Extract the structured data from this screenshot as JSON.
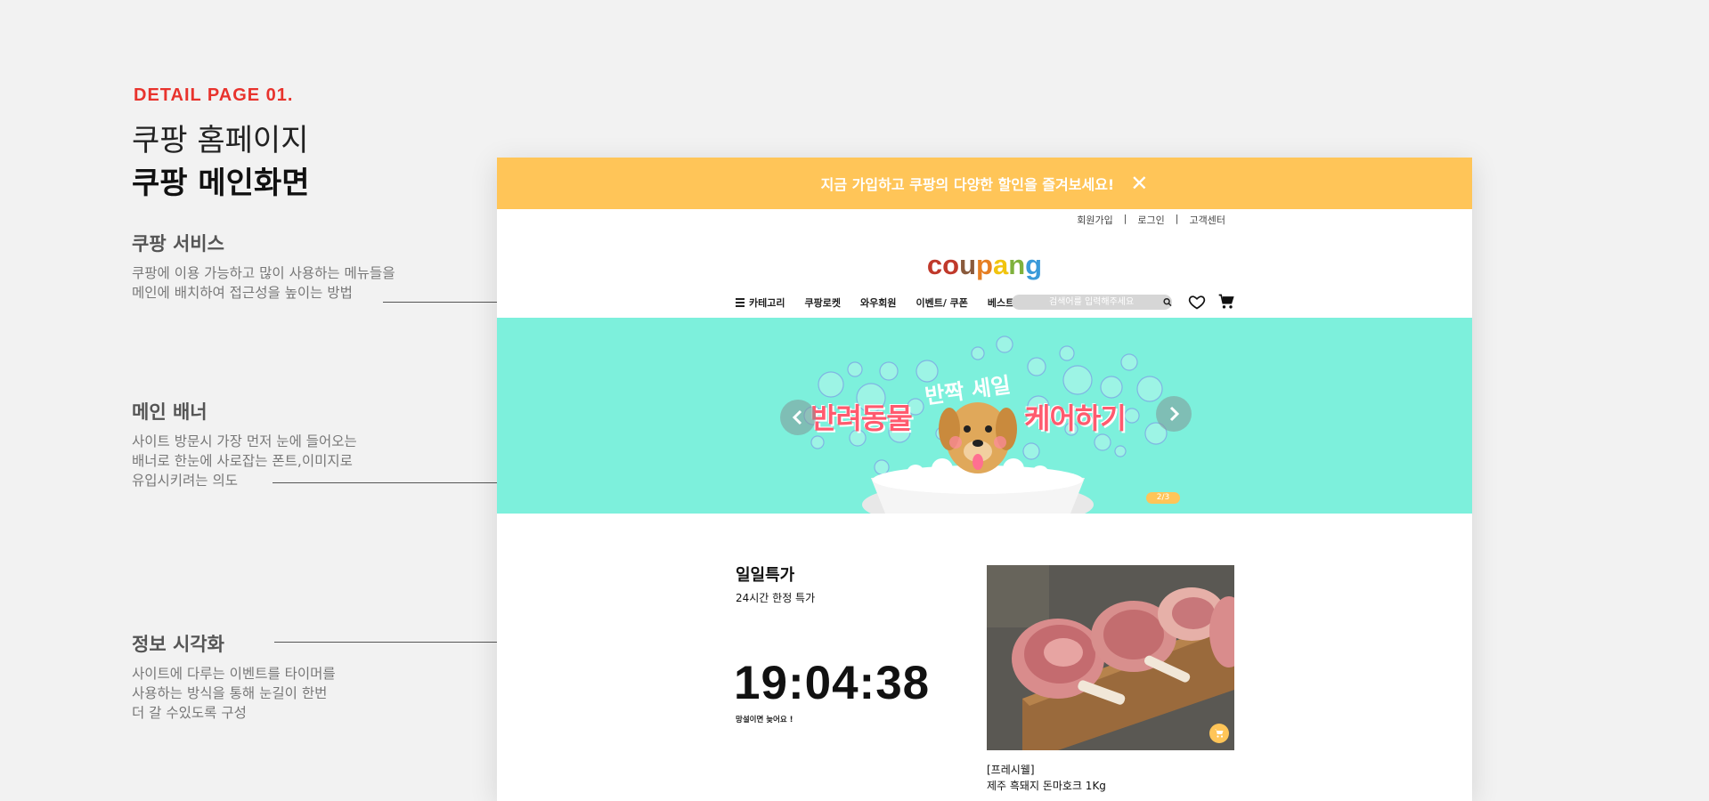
{
  "header": {
    "detail_label": "DETAIL PAGE 01.",
    "title_light": "쿠팡 홈페이지",
    "title_bold": "쿠팡 메인화면"
  },
  "annotations": [
    {
      "title": "쿠팡 서비스",
      "lines": [
        "쿠팡에 이용 가능하고 많이 사용하는  메뉴들을",
        "메인에 배치하여 접근성을 높이는 방법"
      ]
    },
    {
      "title": "메인 배너",
      "lines": [
        "사이트 방문시 가장 먼저 눈에 들어오는",
        "배너로 한눈에 사로잡는 폰트,이미지로",
        "유입시키려는 의도"
      ]
    },
    {
      "title": "정보 시각화",
      "lines": [
        "사이트에 다루는 이벤트를 타이머를",
        "사용하는 방식을 통해 눈길이 한번",
        "더 갈 수있도록 구성"
      ]
    }
  ],
  "site": {
    "promo_text": "지금 가입하고 쿠팡의 다양한 할인을 즐겨보세요!",
    "promo_close": "✕",
    "top_links": [
      "회원가입",
      "로그인",
      "고객센터"
    ],
    "logo_letters": [
      "c",
      "o",
      "u",
      "p",
      "a",
      "n",
      "g"
    ],
    "logo_colors": [
      "#c0392b",
      "#c0392b",
      "#8a5a3c",
      "#e67e22",
      "#f1c40f",
      "#7fb13d",
      "#3a9ad9"
    ],
    "nav": [
      "카테고리",
      "쿠팡로켓",
      "와우회원",
      "이벤트/ 쿠폰",
      "베스트"
    ],
    "search_placeholder": "검색어를 입력해주세요",
    "banner": {
      "main_left": "반려동물",
      "main_right": "케어하기",
      "sub": "반짝 세일",
      "pager": "2/3"
    },
    "deal": {
      "title": "일일특가",
      "subtitle": "24시간 한정 특가",
      "timer": "19:04:38",
      "note": "망설이면 늦어요 !",
      "product_brand": "[프레시웰]",
      "product_name": "제주 흑돼지 돈마호크 1Kg"
    },
    "colors": {
      "promo": "#ffc558",
      "banner_bg": "#7df0dc",
      "accent_red": "#e8332d"
    }
  }
}
